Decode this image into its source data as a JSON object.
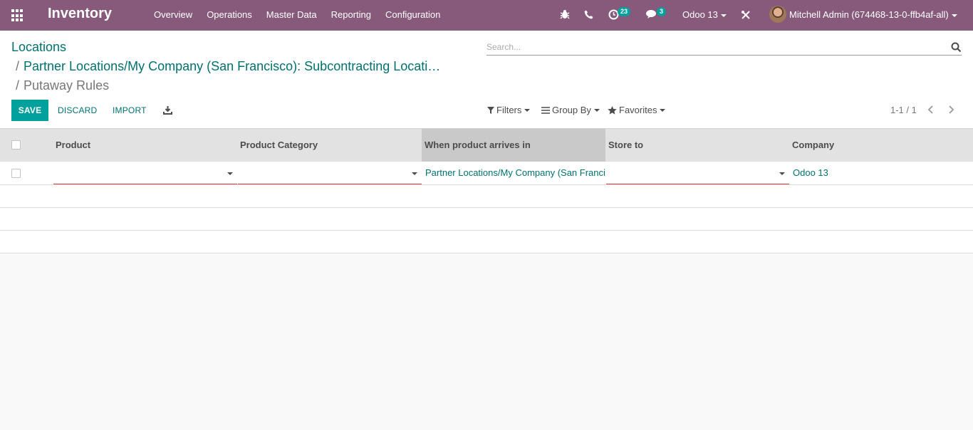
{
  "navbar": {
    "app_name": "Inventory",
    "menu": [
      "Overview",
      "Operations",
      "Master Data",
      "Reporting",
      "Configuration"
    ],
    "activity_count": "23",
    "message_count": "3",
    "company": "Odoo 13",
    "user": "Mitchell Admin (674468-13-0-ffb4af-all)"
  },
  "breadcrumb": {
    "root": "Locations",
    "parent": "Partner Locations/My Company (San Francisco): Subcontracting Locati…",
    "current": "Putaway Rules",
    "separator": "/"
  },
  "search": {
    "placeholder": "Search..."
  },
  "buttons": {
    "save": "SAVE",
    "discard": "DISCARD",
    "import": "IMPORT"
  },
  "filters": {
    "filters": "Filters",
    "group_by": "Group By",
    "favorites": "Favorites"
  },
  "pager": {
    "text": "1-1 / 1"
  },
  "table": {
    "columns": [
      "Product",
      "Product Category",
      "When product arrives in",
      "Store to",
      "Company"
    ],
    "rows": [
      {
        "product": "",
        "product_category": "",
        "arrives_in": "Partner Locations/My Company (San Francisco)",
        "store_to": "",
        "company": "Odoo 13"
      }
    ]
  },
  "colors": {
    "navbar": "#875a7b",
    "primary": "#00a09d",
    "link": "#00716f",
    "required": "#d23f3a"
  }
}
